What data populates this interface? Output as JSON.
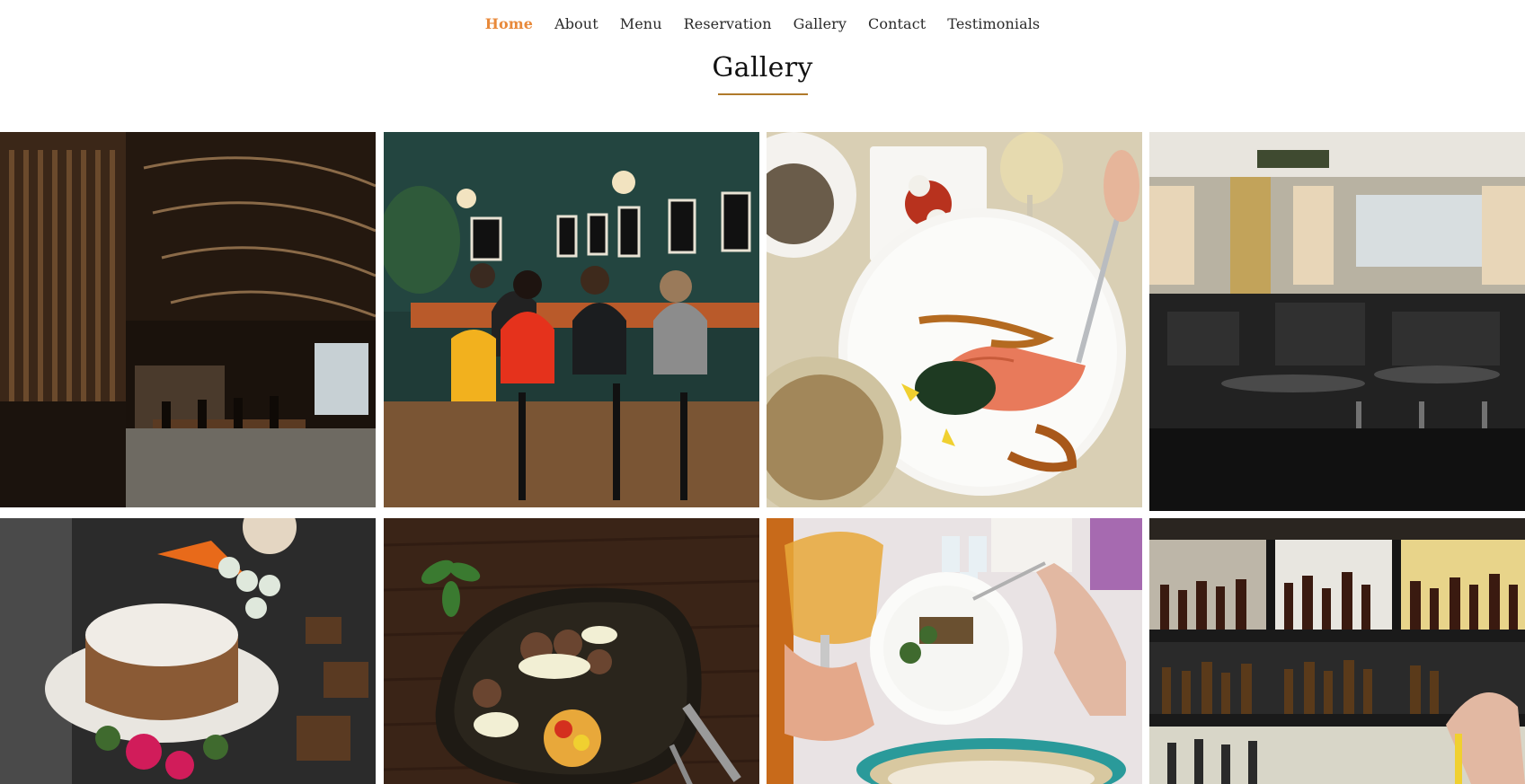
{
  "nav": {
    "items": [
      {
        "label": "Home",
        "active": true
      },
      {
        "label": "About",
        "active": false
      },
      {
        "label": "Menu",
        "active": false
      },
      {
        "label": "Reservation",
        "active": false
      },
      {
        "label": "Gallery",
        "active": false
      },
      {
        "label": "Contact",
        "active": false
      },
      {
        "label": "Testimonials",
        "active": false
      }
    ]
  },
  "section": {
    "title": "Gallery"
  },
  "colors": {
    "accent": "#e8893a",
    "underline": "#b07a2b"
  },
  "gallery": {
    "images": [
      {
        "subject": "restaurant-interior-wooden-slats"
      },
      {
        "subject": "cafe-friends-at-table"
      },
      {
        "subject": "salmon-plate"
      },
      {
        "subject": "dining-room-windows"
      },
      {
        "subject": "cake-with-flowers"
      },
      {
        "subject": "meat-dish-dark-plate"
      },
      {
        "subject": "salad-and-wine"
      },
      {
        "subject": "bar-shelves-bottles"
      }
    ]
  }
}
